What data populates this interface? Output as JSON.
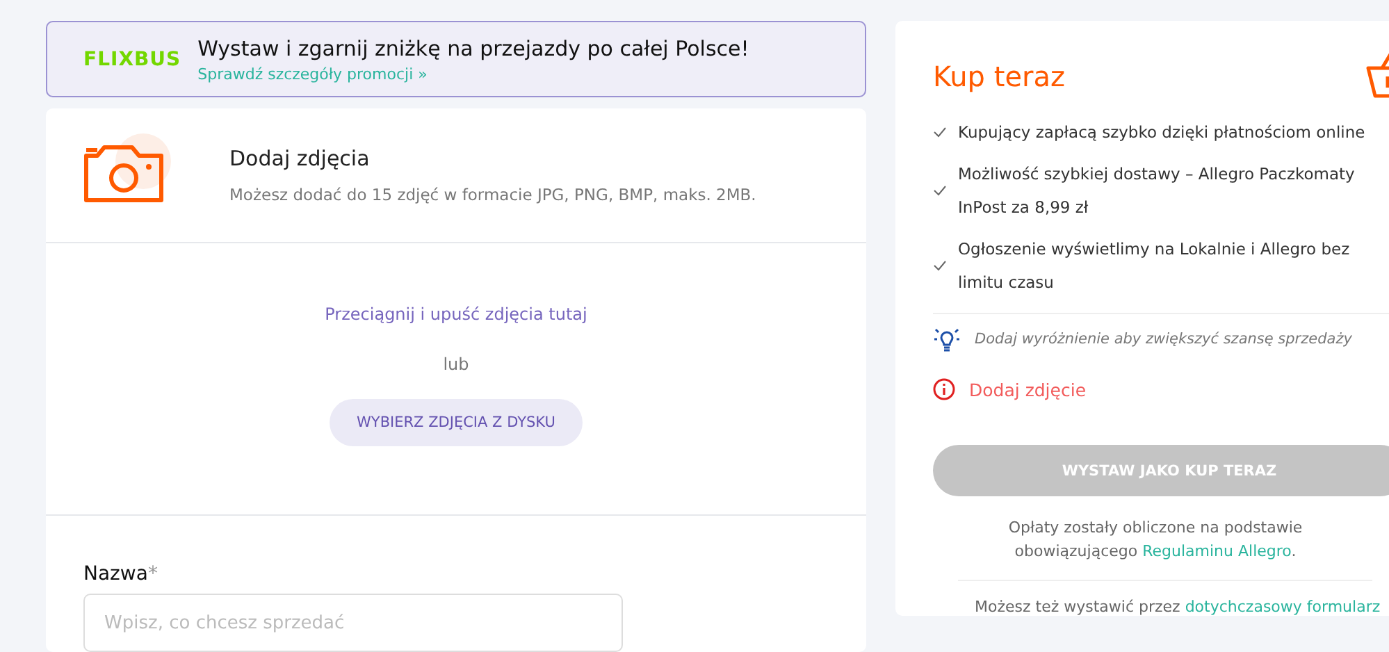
{
  "promo": {
    "logo": "FLIXBUS",
    "title": "Wystaw i zgarnij zniżkę na przejazdy po całej Polsce!",
    "link": "Sprawdź szczegóły promocji »"
  },
  "photos": {
    "title": "Dodaj zdjęcia",
    "subtitle": "Możesz dodać do 15 zdjęć w formacie JPG, PNG, BMP, maks. 2MB.",
    "drop_hint": "Przeciągnij i upuść zdjęcia tutaj",
    "or": "lub",
    "button": "WYBIERZ ZDJĘCIA Z DYSKU"
  },
  "name_field": {
    "label": "Nazwa",
    "required_mark": "*",
    "placeholder": "Wpisz, co chcesz sprzedać"
  },
  "buy_now": {
    "title": "Kup teraz",
    "benefits": [
      "Kupujący zapłacą szybko dzięki płatnościom online",
      "Możliwość szybkiej dostawy – Allegro Paczkomaty InPost za 8,99 zł",
      "Ogłoszenie wyświetlimy na Lokalnie i Allegro bez limitu czasu"
    ],
    "tip": "Dodaj wyróżnienie aby zwiększyć szansę sprzedaży",
    "error": "Dodaj zdjęcie",
    "submit": {
      "label": "WYSTAW JAKO KUP TERAZ",
      "disabled": true
    },
    "fees": {
      "text": "Opłaty zostały obliczone na podstawie obowiązującego",
      "link": "Regulaminu Allegro",
      "suffix": "."
    },
    "alt": {
      "text": "Możesz też wystawić przez",
      "link": "dotychczasowy formularz"
    }
  }
}
